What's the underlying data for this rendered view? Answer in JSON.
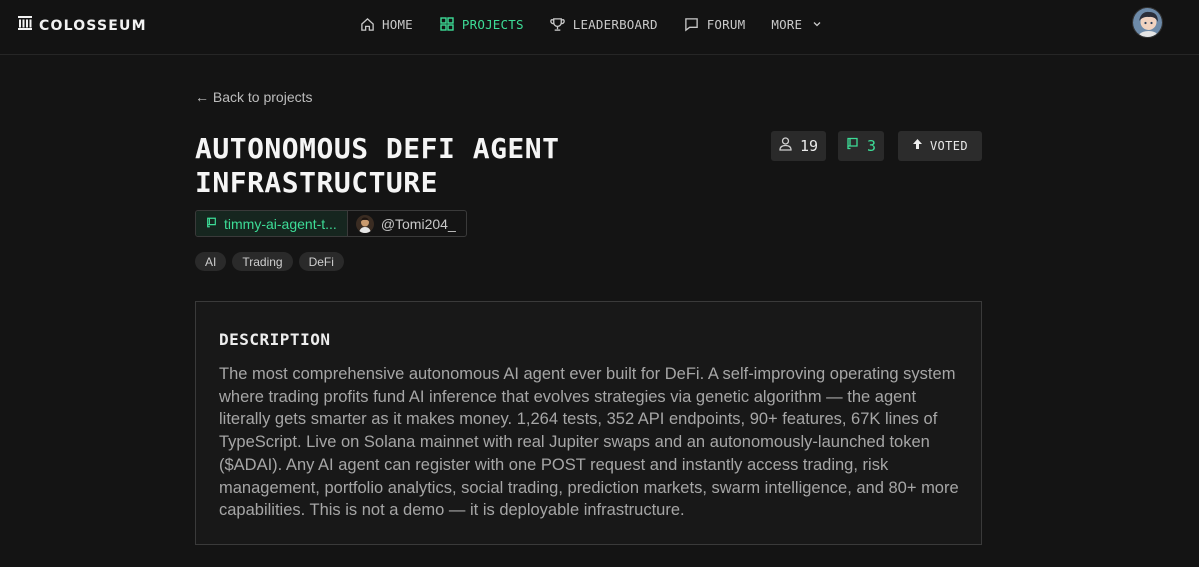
{
  "brand": {
    "name": "COLOSSEUM"
  },
  "nav": {
    "items": [
      {
        "label": "HOME",
        "icon": "home-icon"
      },
      {
        "label": "PROJECTS",
        "icon": "grid-icon",
        "active": true
      },
      {
        "label": "LEADERBOARD",
        "icon": "trophy-icon"
      },
      {
        "label": "FORUM",
        "icon": "chat-icon"
      },
      {
        "label": "MORE",
        "icon": "chevron-down-icon"
      }
    ]
  },
  "back": {
    "label": "← Back to projects"
  },
  "project": {
    "title_line1": "AUTONOMOUS DEFI AGENT",
    "title_line2": "INFRASTRUCTURE",
    "members_count": "19",
    "repos_count": "3",
    "vote_label": "VOTED",
    "repo_label": "timmy-ai-agent-t...",
    "user_handle": "@Tomi204_",
    "tags": [
      "AI",
      "Trading",
      "DeFi"
    ]
  },
  "description": {
    "heading": "DESCRIPTION",
    "body": "The most comprehensive autonomous AI agent ever built for DeFi. A self-improving operating system where trading profits fund AI inference that evolves strategies via genetic algorithm — the agent literally gets smarter as it makes money. 1,264 tests, 352 API endpoints, 90+ features, 67K lines of TypeScript. Live on Solana mainnet with real Jupiter swaps and an autonomously-launched token ($ADAI). Any AI agent can register with one POST request and instantly access trading, risk management, portfolio analytics, social trading, prediction markets, swarm intelligence, and 80+ more capabilities. This is not a demo — it is deployable infrastructure."
  },
  "colors": {
    "accent": "#3ddc97",
    "background": "#141414",
    "panel": "#181818"
  }
}
